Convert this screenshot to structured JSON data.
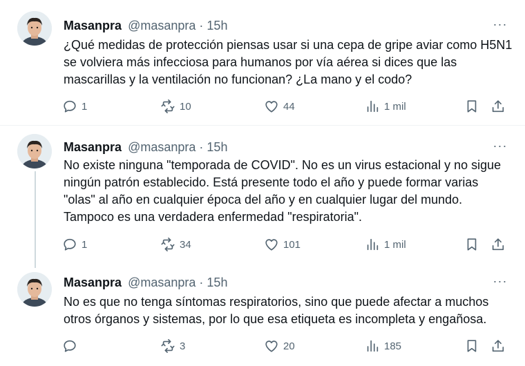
{
  "tweets": [
    {
      "author": "Masanpra",
      "handle": "@masanpra",
      "separator": "·",
      "time": "15h",
      "more": "···",
      "text": "¿Qué medidas de protección piensas usar si una cepa de gripe aviar como H5N1 se volviera más infecciosa para humanos por vía aérea si dices que las mascarillas y la ventilación no funcionan? ¿La mano y el codo?",
      "replies": "1",
      "retweets": "10",
      "likes": "44",
      "views": "1 mil"
    },
    {
      "author": "Masanpra",
      "handle": "@masanpra",
      "separator": "·",
      "time": "15h",
      "more": "···",
      "text": "No existe ninguna \"temporada de COVID\". No es un virus estacional y no sigue ningún patrón establecido. Está presente todo el año y puede formar varias \"olas\" al año en cualquier época del año y en cualquier lugar del mundo. Tampoco es una verdadera enfermedad \"respiratoria\".",
      "replies": "1",
      "retweets": "34",
      "likes": "101",
      "views": "1 mil"
    },
    {
      "author": "Masanpra",
      "handle": "@masanpra",
      "separator": "·",
      "time": "15h",
      "more": "···",
      "text": "No es que no tenga síntomas respiratorios, sino que puede afectar a muchos otros órganos y sistemas, por lo que esa etiqueta es incompleta y engañosa.",
      "replies": "",
      "retweets": "3",
      "likes": "20",
      "views": "185"
    }
  ],
  "icons": {
    "reply": "reply-icon",
    "retweet": "retweet-icon",
    "like": "heart-icon",
    "views": "views-icon",
    "bookmark": "bookmark-icon",
    "share": "share-icon"
  },
  "colors": {
    "text": "#0f1419",
    "secondary": "#536471",
    "thread_line": "#cfd9de",
    "divider": "#eff3f4"
  }
}
